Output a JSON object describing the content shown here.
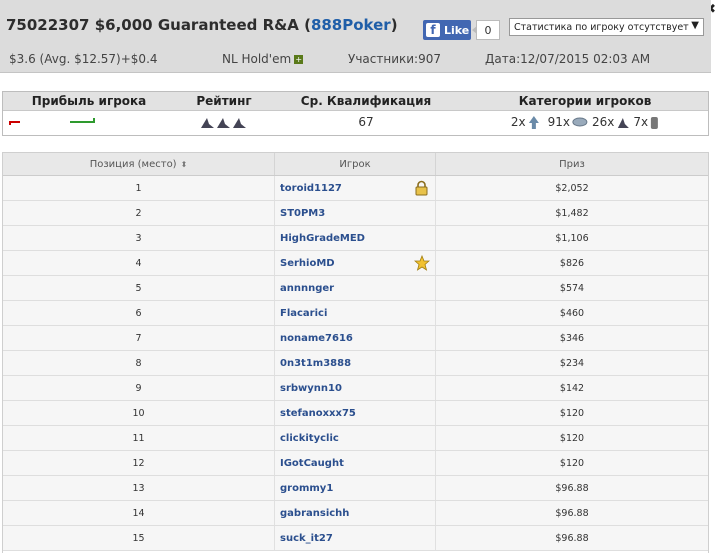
{
  "tournament": {
    "id_title": "75022307 $6,000 Guaranteed R&A (",
    "site": "888Poker",
    "title_close": ")",
    "buyin": "$3.6 (Avg. $12.57)+$0.4",
    "game": "NL Hold'em",
    "participants": "Участники:907",
    "date": "Дата:12/07/2015 02:03 AM"
  },
  "facebook": {
    "like_label": "Like",
    "count": "0"
  },
  "stats_select": {
    "selected": "Статистика по игроку отсутствует"
  },
  "summary": {
    "headers": [
      "Прибыль игрока",
      "Рейтинг",
      "Ср. Квалификация",
      "Категории игроков"
    ],
    "avg_qualification": "67",
    "categories": [
      {
        "count": "2x",
        "icon": "shark-icon"
      },
      {
        "count": "91x",
        "icon": "fish-icon"
      },
      {
        "count": "26x",
        "icon": "eagle-icon"
      },
      {
        "count": "7x",
        "icon": "rock-icon"
      }
    ]
  },
  "results": {
    "headers": {
      "position": "Позиция (место)",
      "player": "Игрок",
      "prize": "Приз"
    },
    "rows": [
      {
        "position": "1",
        "player": "toroid1127",
        "prize": "$2,052",
        "badge": "lock-icon"
      },
      {
        "position": "2",
        "player": "ST0PM3",
        "prize": "$1,482"
      },
      {
        "position": "3",
        "player": "HighGradeMED",
        "prize": "$1,106"
      },
      {
        "position": "4",
        "player": "SerhioMD",
        "prize": "$826",
        "badge": "star-icon"
      },
      {
        "position": "5",
        "player": "annnnger",
        "prize": "$574"
      },
      {
        "position": "6",
        "player": "Flacarici",
        "prize": "$460"
      },
      {
        "position": "7",
        "player": "noname7616",
        "prize": "$346"
      },
      {
        "position": "8",
        "player": "0n3t1m3888",
        "prize": "$234"
      },
      {
        "position": "9",
        "player": "srbwynn10",
        "prize": "$142"
      },
      {
        "position": "10",
        "player": "stefanoxxx75",
        "prize": "$120"
      },
      {
        "position": "11",
        "player": "clickityclic",
        "prize": "$120"
      },
      {
        "position": "12",
        "player": "IGotCaught",
        "prize": "$120"
      },
      {
        "position": "13",
        "player": "grommy1",
        "prize": "$96.88"
      },
      {
        "position": "14",
        "player": "gabransichh",
        "prize": "$96.88"
      },
      {
        "position": "15",
        "player": "suck_it27",
        "prize": "$96.88"
      }
    ]
  },
  "colors": {
    "header_bg": "#dcdcdc",
    "brand": "#1f5ea8",
    "player_link": "#2b4f8e",
    "profit_negative": "#cc0000",
    "profit_positive": "#2e9a2e"
  }
}
